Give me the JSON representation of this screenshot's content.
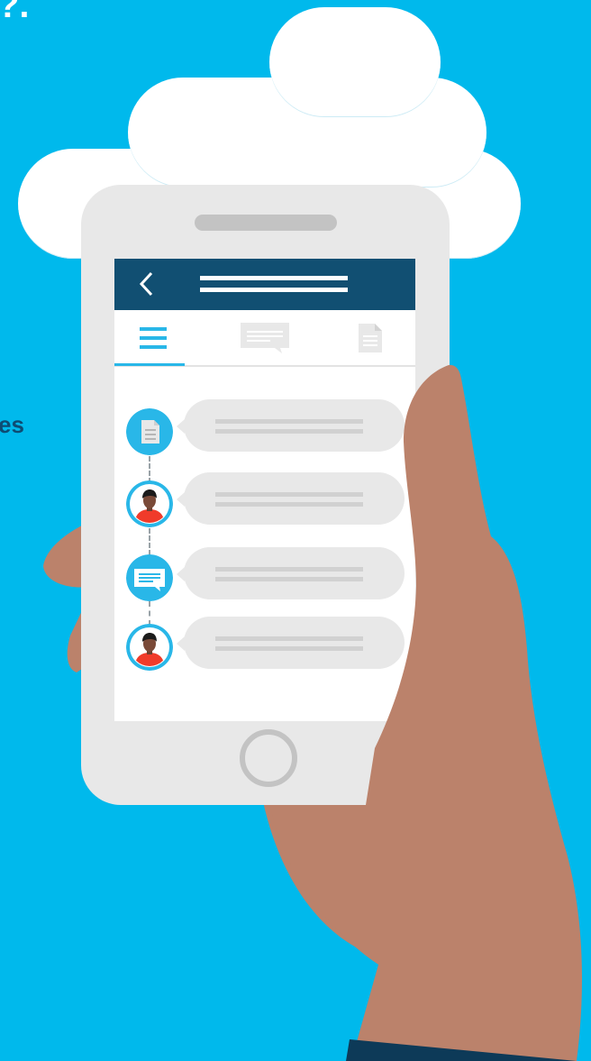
{
  "header": {
    "cut_title_fragment": "?.",
    "cut_side_fragment": "es"
  },
  "colors": {
    "background": "#00b9ec",
    "cloud": "#ffffff",
    "phone_body": "#e8e8e8",
    "app_bar": "#114f72",
    "accent": "#29b7e8",
    "skin": "#bb826b",
    "sleeve": "#0d3a58"
  },
  "phone": {
    "app_bar": {
      "back_icon": "chevron-left-icon",
      "title_icon": "title-lines-icon"
    },
    "tabs": [
      {
        "id": "list",
        "icon": "list-icon",
        "active": true
      },
      {
        "id": "messages",
        "icon": "message-icon",
        "active": false
      },
      {
        "id": "documents",
        "icon": "document-icon",
        "active": false
      }
    ],
    "timeline": [
      {
        "kind": "document",
        "icon": "document-icon"
      },
      {
        "kind": "person",
        "icon": "person-avatar-icon"
      },
      {
        "kind": "message",
        "icon": "message-icon"
      },
      {
        "kind": "person",
        "icon": "person-avatar-icon"
      }
    ]
  }
}
